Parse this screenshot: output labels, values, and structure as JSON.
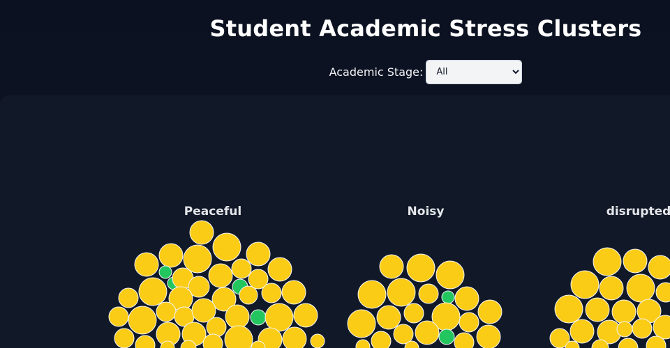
{
  "title": "Student Academic Stress Clusters",
  "filter": {
    "label": "Academic Stage:",
    "selected": "All",
    "options": [
      "All"
    ]
  },
  "colors": {
    "background": "#0b1120",
    "panel": "#111827",
    "yellow": "#facc15",
    "green": "#22c55e",
    "stroke": "#f3f4f6"
  },
  "chart_data": {
    "type": "bubble-cluster",
    "clusters": [
      {
        "name": "Peaceful",
        "yellow_count": 42,
        "green_count": 4
      },
      {
        "name": "Noisy",
        "yellow_count": 26,
        "green_count": 2
      },
      {
        "name": "disrupted",
        "yellow_count": 28,
        "green_count": 0
      }
    ]
  }
}
